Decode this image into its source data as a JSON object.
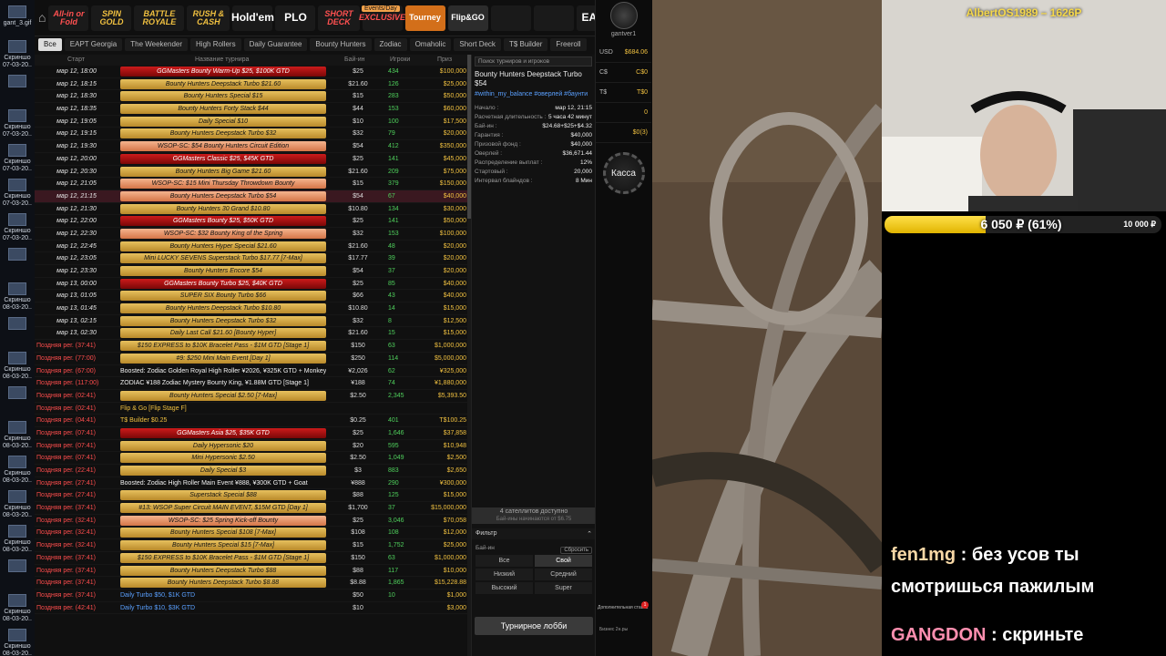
{
  "desktop_icons": [
    "gant_3.gif",
    "Скриншо 07-03-20..",
    "",
    "Скриншо 07-03-20..",
    "Скриншо 07-03-20..",
    "Скриншо 07-03-20..",
    "Скриншо 07-03-20..",
    "",
    "Скриншо 08-03-20..",
    "",
    "Скриншо 08-03-20..",
    "",
    "Скриншо 08-03-20..",
    "Скриншо 08-03-20..",
    "Скриншо 08-03-20..",
    "Скриншо 08-03-20..",
    "",
    "Скриншо 08-03-20..",
    "Скриншо 08-03-20.."
  ],
  "top_tiles": [
    "All-in or Fold",
    "SPIN GOLD",
    "BATTLE ROYALE",
    "RUSH & CASH",
    "Hold'em",
    "PLO",
    "SHORT DECK",
    "EXCLUSIVE",
    "Tourney",
    "Flip&GO",
    "",
    "",
    "EAPT",
    "WSOP EXPRESS"
  ],
  "top_badges": {
    "casino": "CASINO",
    "events": "Events/Day"
  },
  "filters": [
    "Все",
    "EAPT Georgia",
    "The Weekender",
    "High Rollers",
    "Daily Guarantee",
    "Bounty Hunters",
    "Zodiac",
    "Omaholic",
    "Short Deck",
    "T$ Builder",
    "Freeroll"
  ],
  "table_headers": {
    "start": "Старт",
    "name": "Название турнира",
    "buyin": "Бай-ин",
    "players": "Игроки",
    "prize": "Приз"
  },
  "rows": [
    {
      "start": "мар 12, 18:00",
      "name": "GGMasters Bounty Warm-Up $25, $100K GTD",
      "style": "red",
      "buyin": "$25",
      "players": "434",
      "prize": "$100,000"
    },
    {
      "start": "мар 12, 18:15",
      "name": "Bounty Hunters Deepstack Turbo $21.60",
      "style": "gold",
      "buyin": "$21.60",
      "players": "126",
      "prize": "$25,000"
    },
    {
      "start": "мар 12, 18:30",
      "name": "Bounty Hunters Special $15",
      "style": "gold",
      "buyin": "$15",
      "players": "283",
      "prize": "$50,000"
    },
    {
      "start": "мар 12, 18:35",
      "name": "Bounty Hunters Forty Stack $44",
      "style": "gold",
      "buyin": "$44",
      "players": "153",
      "prize": "$60,000"
    },
    {
      "start": "мар 12, 19:05",
      "name": "Daily Special $10",
      "style": "gold",
      "buyin": "$10",
      "players": "100",
      "prize": "$17,500"
    },
    {
      "start": "мар 12, 19:15",
      "name": "Bounty Hunters Deepstack Turbo $32",
      "style": "gold",
      "buyin": "$32",
      "players": "79",
      "prize": "$20,000"
    },
    {
      "start": "мар 12, 19:30",
      "name": "WSOP-SC: $54 Bounty Hunters Circuit Edition",
      "style": "pink",
      "buyin": "$54",
      "players": "412",
      "prize": "$350,000"
    },
    {
      "start": "мар 12, 20:00",
      "name": "GGMasters Classic $25, $45K GTD",
      "style": "red",
      "buyin": "$25",
      "players": "141",
      "prize": "$45,000"
    },
    {
      "start": "мар 12, 20:30",
      "name": "Bounty Hunters Big Game $21.60",
      "style": "gold",
      "buyin": "$21.60",
      "players": "209",
      "prize": "$75,000"
    },
    {
      "start": "мар 12, 21:05",
      "name": "WSOP-SC: $15 Mini Thursday Throwdown Bounty",
      "style": "pink",
      "buyin": "$15",
      "players": "379",
      "prize": "$150,000"
    },
    {
      "start": "мар 12, 21:15",
      "name": "Bounty Hunters Deepstack Turbo $54",
      "style": "pink",
      "buyin": "$54",
      "players": "67",
      "prize": "$40,000",
      "selected": true
    },
    {
      "start": "мар 12, 21:30",
      "name": "Bounty Hunters 30 Grand $10.80",
      "style": "gold",
      "buyin": "$10.80",
      "players": "134",
      "prize": "$30,000"
    },
    {
      "start": "мар 12, 22:00",
      "name": "GGMasters Bounty $25, $50K GTD",
      "style": "red",
      "buyin": "$25",
      "players": "141",
      "prize": "$50,000"
    },
    {
      "start": "мар 12, 22:30",
      "name": "WSOP-SC: $32 Bounty King of the Spring",
      "style": "pink",
      "buyin": "$32",
      "players": "153",
      "prize": "$100,000"
    },
    {
      "start": "мар 12, 22:45",
      "name": "Bounty Hunters Hyper Special $21.60",
      "style": "gold",
      "buyin": "$21.60",
      "players": "48",
      "prize": "$20,000"
    },
    {
      "start": "мар 12, 23:05",
      "name": "Mini LUCKY SEVENS Superstack Turbo $17.77 [7-Max]",
      "style": "gold",
      "buyin": "$17.77",
      "players": "39",
      "prize": "$20,000"
    },
    {
      "start": "мар 12, 23:30",
      "name": "Bounty Hunters Encore $54",
      "style": "gold",
      "buyin": "$54",
      "players": "37",
      "prize": "$20,000"
    },
    {
      "start": "мар 13, 00:00",
      "name": "GGMasters Bounty Turbo $25, $40K GTD",
      "style": "red",
      "buyin": "$25",
      "players": "85",
      "prize": "$40,000"
    },
    {
      "start": "мар 13, 01:05",
      "name": "SUPER SIX Bounty Turbo $66",
      "style": "gold",
      "buyin": "$66",
      "players": "43",
      "prize": "$40,000"
    },
    {
      "start": "мар 13, 01:45",
      "name": "Bounty Hunters Deepstack Turbo $10.80",
      "style": "gold",
      "buyin": "$10.80",
      "players": "14",
      "prize": "$15,000"
    },
    {
      "start": "мар 13, 02:15",
      "name": "Bounty Hunters Deepstack Turbo $32",
      "style": "gold",
      "buyin": "$32",
      "players": "8",
      "prize": "$12,500"
    },
    {
      "start": "мар 13, 02:30",
      "name": "Daily Last Call $21.60 [Bounty Hyper]",
      "style": "gold",
      "buyin": "$21.60",
      "players": "15",
      "prize": "$15,000"
    },
    {
      "start": "Поздняя рег. (37:41)",
      "name": "$150 EXPRESS to $10K Bracelet Pass - $1M GTD [Stage 1]",
      "style": "gold",
      "buyin": "$150",
      "players": "63",
      "prize": "$1,000,000",
      "late": true
    },
    {
      "start": "Поздняя рег. (77:00)",
      "name": "#9: $250 Mini Main Event [Day 1]",
      "style": "gold",
      "buyin": "$250",
      "players": "114",
      "prize": "$5,000,000",
      "late": true
    },
    {
      "start": "Поздняя рег. (67:00)",
      "name": "Boosted: Zodiac Golden Royal High Roller ¥2026, ¥325K GTD + Monkey",
      "style": "plain",
      "buyin": "¥2,026",
      "players": "62",
      "prize": "¥325,000",
      "late": true
    },
    {
      "start": "Поздняя рег. (117:00)",
      "name": "ZODIAC ¥188 Zodiac Mystery Bounty King, ¥1.88M GTD [Stage 1]",
      "style": "plain",
      "buyin": "¥188",
      "players": "74",
      "prize": "¥1,880,000",
      "late": true
    },
    {
      "start": "Поздняя рег. (02:41)",
      "name": "Bounty Hunters Special $2.50 [7-Max]",
      "style": "gold",
      "buyin": "$2.50",
      "players": "2,345",
      "prize": "$5,393.50",
      "late": true
    },
    {
      "start": "Поздняя рег. (02:41)",
      "name": "Flip & Go [Flip Stage F]",
      "style": "gold2",
      "buyin": "",
      "players": "",
      "prize": "",
      "late": true
    },
    {
      "start": "Поздняя рег. (04:41)",
      "name": "T$ Builder $0.25",
      "style": "gold2",
      "buyin": "$0.25",
      "players": "401",
      "prize": "T$100.25",
      "late": true
    },
    {
      "start": "Поздняя рег. (07:41)",
      "name": "GGMasters Asia $25, $35K GTD",
      "style": "red",
      "buyin": "$25",
      "players": "1,646",
      "prize": "$37,858",
      "late": true
    },
    {
      "start": "Поздняя рег. (07:41)",
      "name": "Daily Hypersonic $20",
      "style": "gold",
      "buyin": "$20",
      "players": "595",
      "prize": "$10,948",
      "late": true
    },
    {
      "start": "Поздняя рег. (07:41)",
      "name": "Mini Hypersonic $2.50",
      "style": "gold",
      "buyin": "$2.50",
      "players": "1,049",
      "prize": "$2,500",
      "late": true
    },
    {
      "start": "Поздняя рег. (22:41)",
      "name": "Daily Special $3",
      "style": "gold",
      "buyin": "$3",
      "players": "883",
      "prize": "$2,650",
      "late": true
    },
    {
      "start": "Поздняя рег. (27:41)",
      "name": "Boosted: Zodiac High Roller Main Event ¥888, ¥300K GTD + Goat",
      "style": "plain",
      "buyin": "¥888",
      "players": "290",
      "prize": "¥300,000",
      "late": true
    },
    {
      "start": "Поздняя рег. (27:41)",
      "name": "Superstack Special $88",
      "style": "gold",
      "buyin": "$88",
      "players": "125",
      "prize": "$15,000",
      "late": true
    },
    {
      "start": "Поздняя рег. (37:41)",
      "name": "#13: WSOP Super Circuit MAIN EVENT, $15M GTD [Day 1]",
      "style": "gold",
      "buyin": "$1,700",
      "players": "37",
      "prize": "$15,000,000",
      "late": true
    },
    {
      "start": "Поздняя рег. (32:41)",
      "name": "WSOP-SC: $25 Spring Kick-off Bounty",
      "style": "pink",
      "buyin": "$25",
      "players": "3,046",
      "prize": "$70,058",
      "late": true
    },
    {
      "start": "Поздняя рег. (32:41)",
      "name": "Bounty Hunters Special $108 [7-Max]",
      "style": "gold",
      "buyin": "$108",
      "players": "108",
      "prize": "$12,000",
      "late": true
    },
    {
      "start": "Поздняя рег. (32:41)",
      "name": "Bounty Hunters Special $15 [7-Max]",
      "style": "gold",
      "buyin": "$15",
      "players": "1,752",
      "prize": "$25,000",
      "late": true
    },
    {
      "start": "Поздняя рег. (37:41)",
      "name": "$150 EXPRESS to $10K Bracelet Pass - $1M GTD [Stage 1]",
      "style": "gold",
      "buyin": "$150",
      "players": "63",
      "prize": "$1,000,000",
      "late": true
    },
    {
      "start": "Поздняя рег. (37:41)",
      "name": "Bounty Hunters Deepstack Turbo $88",
      "style": "gold",
      "buyin": "$88",
      "players": "117",
      "prize": "$10,000",
      "late": true
    },
    {
      "start": "Поздняя рег. (37:41)",
      "name": "Bounty Hunters Deepstack Turbo $8.88",
      "style": "gold",
      "buyin": "$8.88",
      "players": "1,865",
      "prize": "$15,228.88",
      "late": true
    },
    {
      "start": "Поздняя рег. (37:41)",
      "name": "Daily Turbo $50, $1K GTD",
      "style": "blue",
      "buyin": "$50",
      "players": "10",
      "prize": "$1,000",
      "late": true
    },
    {
      "start": "Поздняя рег. (42:41)",
      "name": "Daily Turbo $10, $3K GTD",
      "style": "blue",
      "buyin": "$10",
      "players": "",
      "prize": "$3,000",
      "late": true
    }
  ],
  "details": {
    "search_placeholder": "Поиск турниров и игроков",
    "title": "Bounty Hunters Deepstack Turbo $54",
    "tags": "#within_my_balance #оверлей #баунти",
    "fields": [
      {
        "k": "Начало :",
        "v": "мар 12, 21:15"
      },
      {
        "k": "Расчетная длительность :",
        "v": "5 часа 42 минут"
      },
      {
        "k": "Бай-ин :",
        "v": "$24.68+$25+$4.32"
      },
      {
        "k": "Гарантия :",
        "v": "$40,000"
      },
      {
        "k": "Призовой фонд :",
        "v": "$40,000"
      },
      {
        "k": "Оверлей :",
        "v": "$36,671.44"
      },
      {
        "k": "Распределение выплат :",
        "v": "12%"
      },
      {
        "k": "Стартовый :",
        "v": "20,000"
      },
      {
        "k": "Интервал блайндов :",
        "v": "8 Мин"
      }
    ],
    "satellites": "4 сателлитов доступно",
    "satellites_sub": "Бай-ины начинаются от $6.75",
    "filter_label": "Фильтр",
    "buyin_label": "Бай-ин",
    "reset": "Сбросить",
    "buyin_options": [
      "Все",
      "Свой",
      "Низкий",
      "Средний",
      "Высокий",
      "Super"
    ],
    "lobby_button": "Турнирное лобби"
  },
  "profile": {
    "name": "gantver1",
    "balances": [
      {
        "cur": "USD",
        "val": "$684.06"
      },
      {
        "cur": "C$",
        "val": "C$0"
      },
      {
        "cur": "T$",
        "val": "T$0"
      },
      {
        "cur": "",
        "val": "0"
      },
      {
        "cur": "",
        "val": "$0(3)"
      }
    ],
    "cashier": "Касса",
    "extra_label": "Дополнительная ставка",
    "extra_badge": "1",
    "small_label": "Бизнес 2н.ры"
  },
  "stream": {
    "cam_name": "AlbertOS1989 – 1626Р",
    "goal_text": "6 050 ₽ (61%)",
    "goal_percent": 61,
    "goal_max": "10 000 ₽",
    "chat": [
      {
        "user": "fen1mg",
        "text": " : без усов ты"
      },
      {
        "user": "",
        "text": "смотришься пажилым"
      },
      {
        "user": "GANGDON",
        "text": " : скриньте"
      }
    ]
  }
}
